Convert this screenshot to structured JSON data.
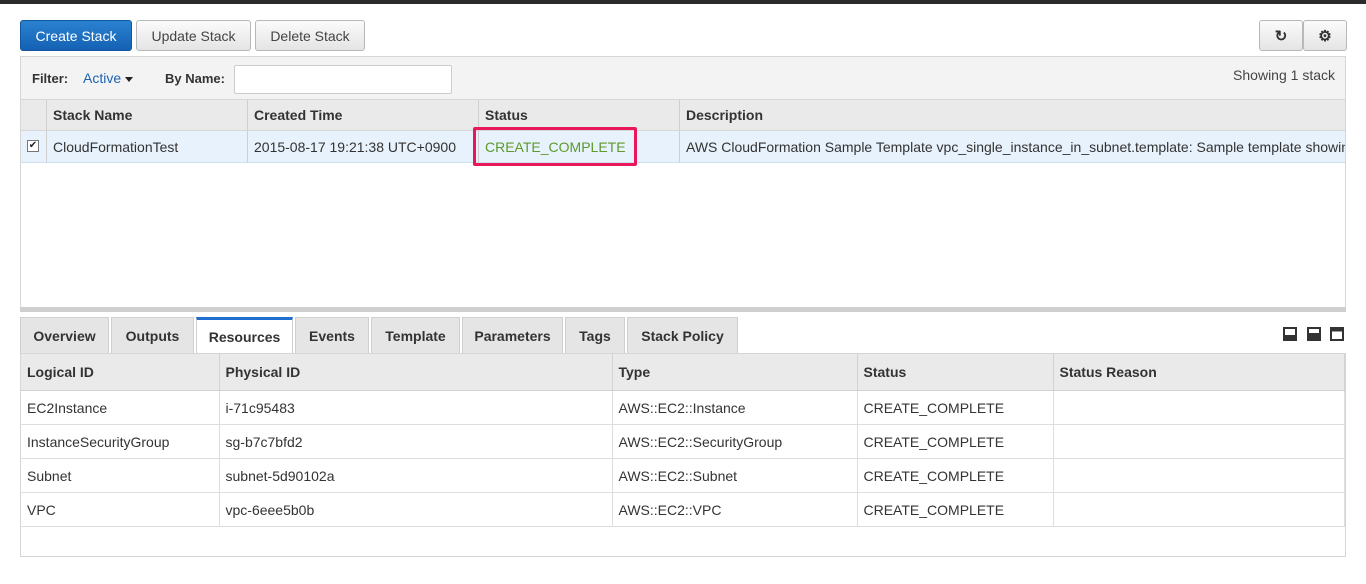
{
  "toolbar": {
    "create": "Create Stack",
    "update": "Update Stack",
    "delete": "Delete Stack",
    "refresh_icon": "↻",
    "settings_icon": "⚙"
  },
  "filter": {
    "label": "Filter:",
    "value": "Active",
    "byname_label": "By Name:",
    "byname_value": "",
    "showing": "Showing 1 stack"
  },
  "stacks": {
    "headers": [
      "Stack Name",
      "Created Time",
      "Status",
      "Description"
    ],
    "row": {
      "checked": true,
      "name": "CloudFormationTest",
      "created": "2015-08-17 19:21:38 UTC+0900",
      "status": "CREATE_COMPLETE",
      "description": "AWS CloudFormation Sample Template vpc_single_instance_in_subnet.template: Sample template showing how to create a VPC"
    }
  },
  "tabs": [
    "Overview",
    "Outputs",
    "Resources",
    "Events",
    "Template",
    "Parameters",
    "Tags",
    "Stack Policy"
  ],
  "active_tab": "Resources",
  "resources": {
    "headers": [
      "Logical ID",
      "Physical ID",
      "Type",
      "Status",
      "Status Reason"
    ],
    "rows": [
      {
        "logical": "EC2Instance",
        "physical": "i-71c95483",
        "type": "AWS::EC2::Instance",
        "status": "CREATE_COMPLETE",
        "reason": ""
      },
      {
        "logical": "InstanceSecurityGroup",
        "physical": "sg-b7c7bfd2",
        "type": "AWS::EC2::SecurityGroup",
        "status": "CREATE_COMPLETE",
        "reason": ""
      },
      {
        "logical": "Subnet",
        "physical": "subnet-5d90102a",
        "type": "AWS::EC2::Subnet",
        "status": "CREATE_COMPLETE",
        "reason": ""
      },
      {
        "logical": "VPC",
        "physical": "vpc-6eee5b0b",
        "type": "AWS::EC2::VPC",
        "status": "CREATE_COMPLETE",
        "reason": ""
      }
    ]
  },
  "colors": {
    "primary": "#1461b3",
    "status_complete": "#5c9a2a",
    "highlight": "#e8185b",
    "active_tab": "#1e6fcf"
  }
}
